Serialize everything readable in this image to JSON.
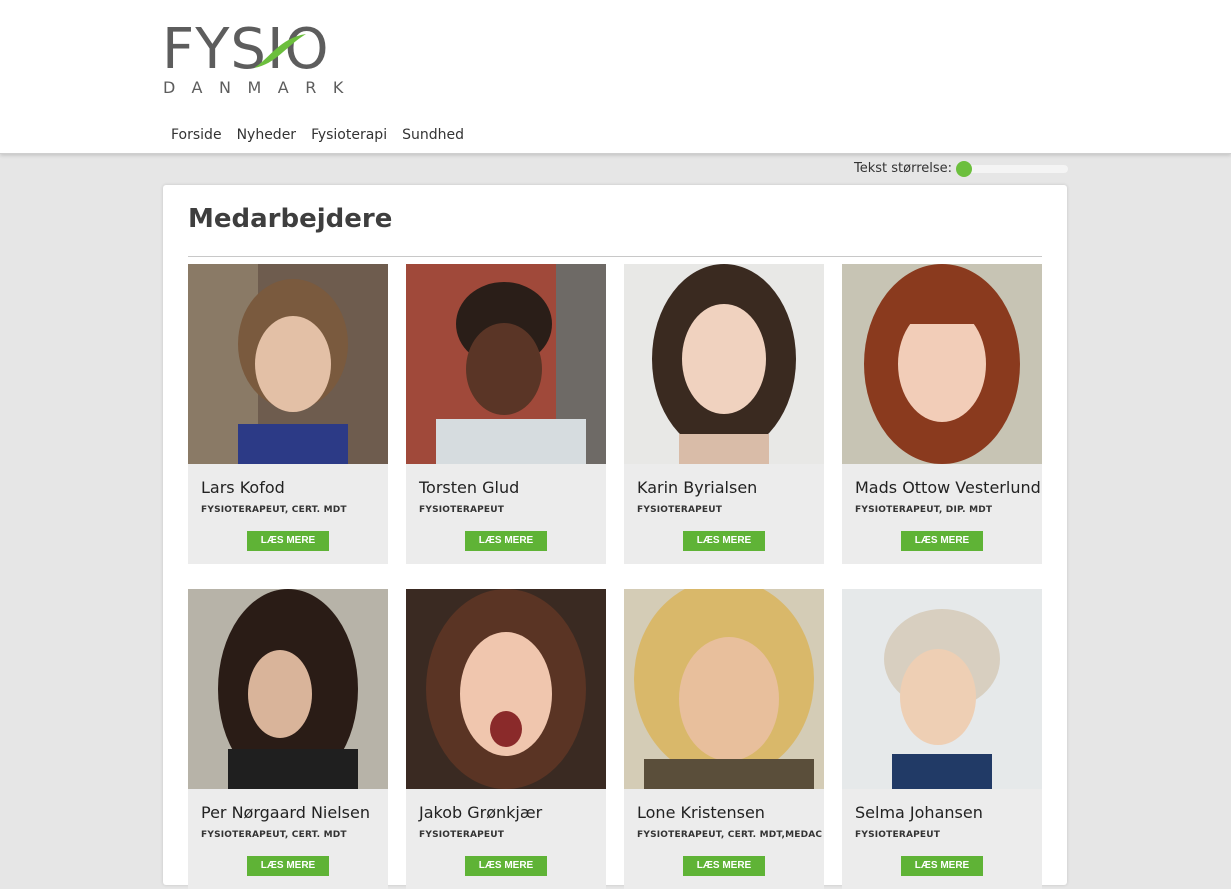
{
  "logo": {
    "top": "FYSIO",
    "bottom": "DANMARK",
    "accent": "#6cbf3d"
  },
  "nav": [
    "Forside",
    "Nyheder",
    "Fysioterapi",
    "Sundhed"
  ],
  "text_size": {
    "label": "Tekst størrelse:",
    "level": 0
  },
  "page_title": "Medarbejdere",
  "button_label": "LÆS MERE",
  "staff": [
    {
      "name": "Lars Kofod",
      "role": "FYSIOTERAPEUT, CERT. MDT"
    },
    {
      "name": "Torsten Glud",
      "role": "FYSIOTERAPEUT"
    },
    {
      "name": "Karin Byrialsen",
      "role": "FYSIOTERAPEUT"
    },
    {
      "name": "Mads Ottow Vesterlund",
      "role": "FYSIOTERAPEUT, DIP. MDT"
    },
    {
      "name": "Per Nørgaard Nielsen",
      "role": "FYSIOTERAPEUT, CERT. MDT"
    },
    {
      "name": "Jakob Grønkjær",
      "role": "FYSIOTERAPEUT"
    },
    {
      "name": "Lone Kristensen",
      "role": "FYSIOTERAPEUT, CERT. MDT,MEDAC"
    },
    {
      "name": "Selma Johansen",
      "role": "FYSIOTERAPEUT"
    }
  ]
}
